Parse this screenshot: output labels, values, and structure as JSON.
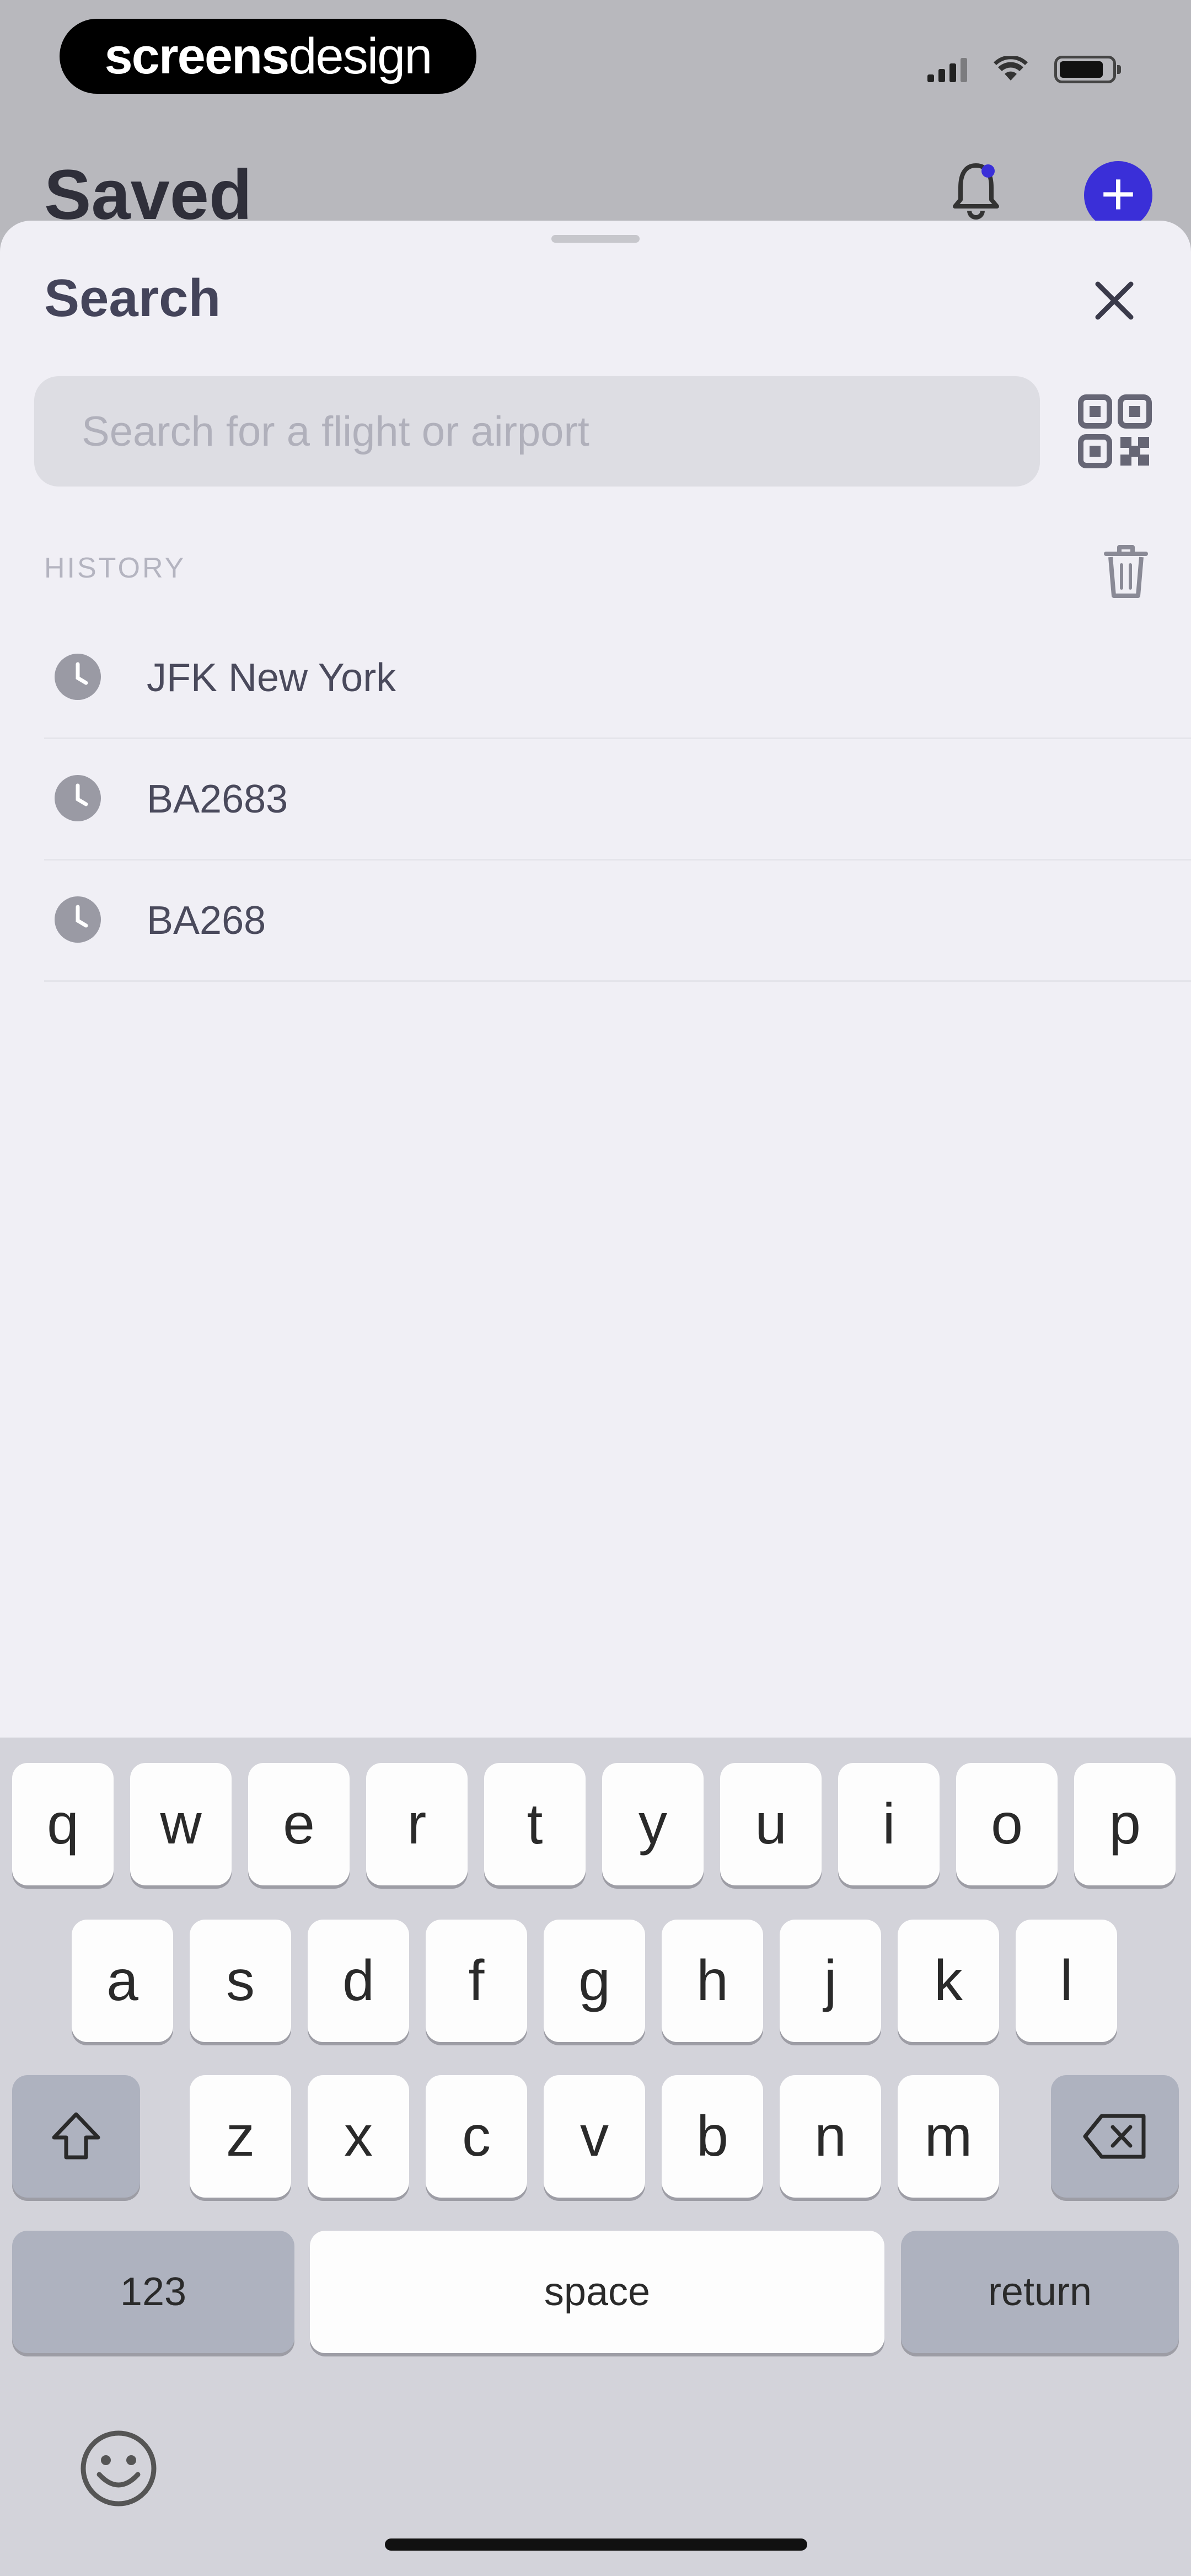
{
  "status_bar": {
    "brand_bold": "screens",
    "brand_thin": "design"
  },
  "background": {
    "title": "Saved"
  },
  "sheet": {
    "title": "Search",
    "search": {
      "placeholder": "Search for a flight or airport",
      "value": ""
    },
    "history_label": "HISTORY",
    "history": [
      {
        "label": "JFK New York"
      },
      {
        "label": "BA2683"
      },
      {
        "label": "BA268"
      }
    ]
  },
  "keyboard": {
    "row1": [
      "q",
      "w",
      "e",
      "r",
      "t",
      "y",
      "u",
      "i",
      "o",
      "p"
    ],
    "row2": [
      "a",
      "s",
      "d",
      "f",
      "g",
      "h",
      "j",
      "k",
      "l"
    ],
    "row3": [
      "z",
      "x",
      "c",
      "v",
      "b",
      "n",
      "m"
    ],
    "numbers_label": "123",
    "space_label": "space",
    "return_label": "return"
  },
  "colors": {
    "accent": "#3a2fd8",
    "sheet_bg": "#f0eff5",
    "keyboard_bg": "#d3d3da"
  }
}
